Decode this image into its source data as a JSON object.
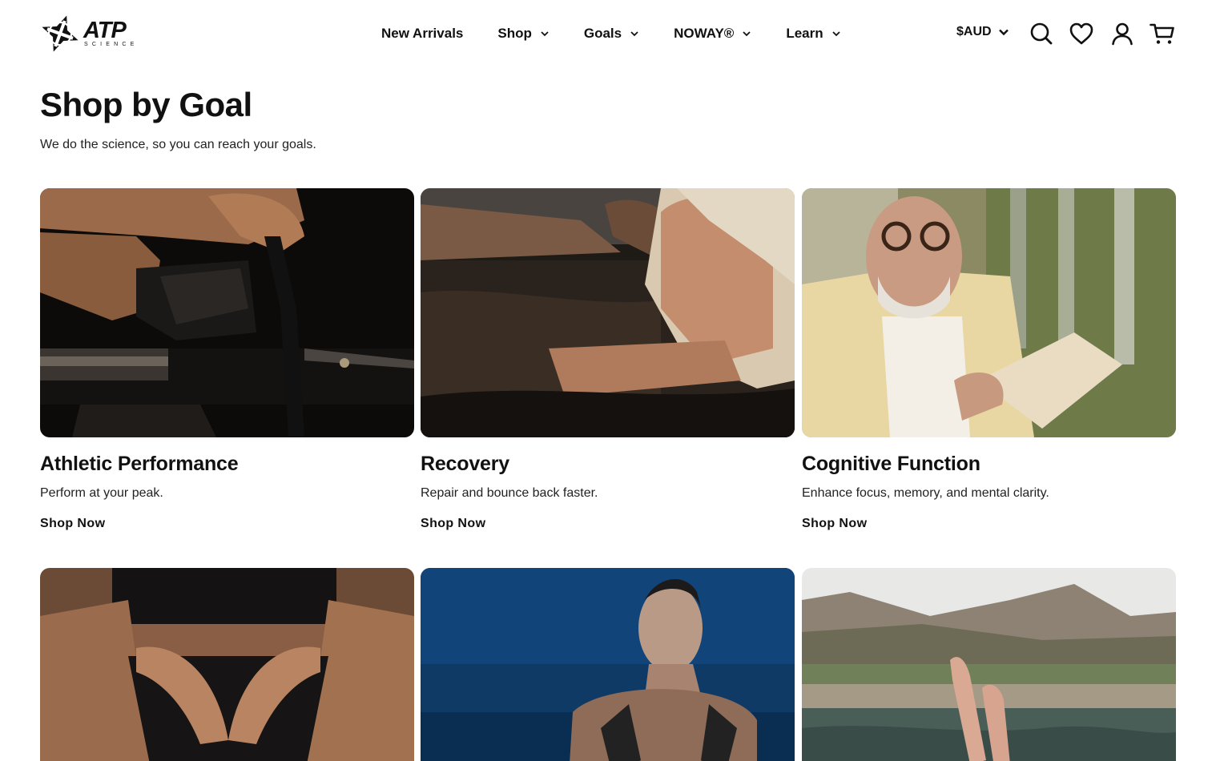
{
  "brand": {
    "logo_main": "ATP",
    "logo_sub": "SCIENCE"
  },
  "nav": {
    "items": [
      {
        "label": "New Arrivals",
        "has_dropdown": false
      },
      {
        "label": "Shop",
        "has_dropdown": true
      },
      {
        "label": "Goals",
        "has_dropdown": true
      },
      {
        "label": "NOWAY®",
        "has_dropdown": true
      },
      {
        "label": "Learn",
        "has_dropdown": true
      }
    ]
  },
  "header_actions": {
    "currency_label": "$AUD",
    "icons": [
      "search-icon",
      "heart-icon",
      "account-icon",
      "cart-icon"
    ]
  },
  "page": {
    "title": "Shop by Goal",
    "subtitle": "We do the science, so you can reach your goals."
  },
  "goals": [
    {
      "title": "Athletic Performance",
      "description": "Perform at your peak.",
      "link_label": "Shop Now",
      "image": "rowing-machine-photo"
    },
    {
      "title": "Recovery",
      "description": "Repair and bounce back faster.",
      "link_label": "Shop Now",
      "image": "cold-plunge-photo"
    },
    {
      "title": "Cognitive Function",
      "description": "Enhance focus, memory, and mental clarity.",
      "link_label": "Shop Now",
      "image": "man-reading-photo"
    },
    {
      "image": "hands-on-abdomen-photo"
    },
    {
      "image": "underwater-swimmer-photo"
    },
    {
      "image": "feet-in-pool-mountains-photo"
    }
  ],
  "colors": {
    "text": "#111111",
    "background": "#ffffff"
  }
}
